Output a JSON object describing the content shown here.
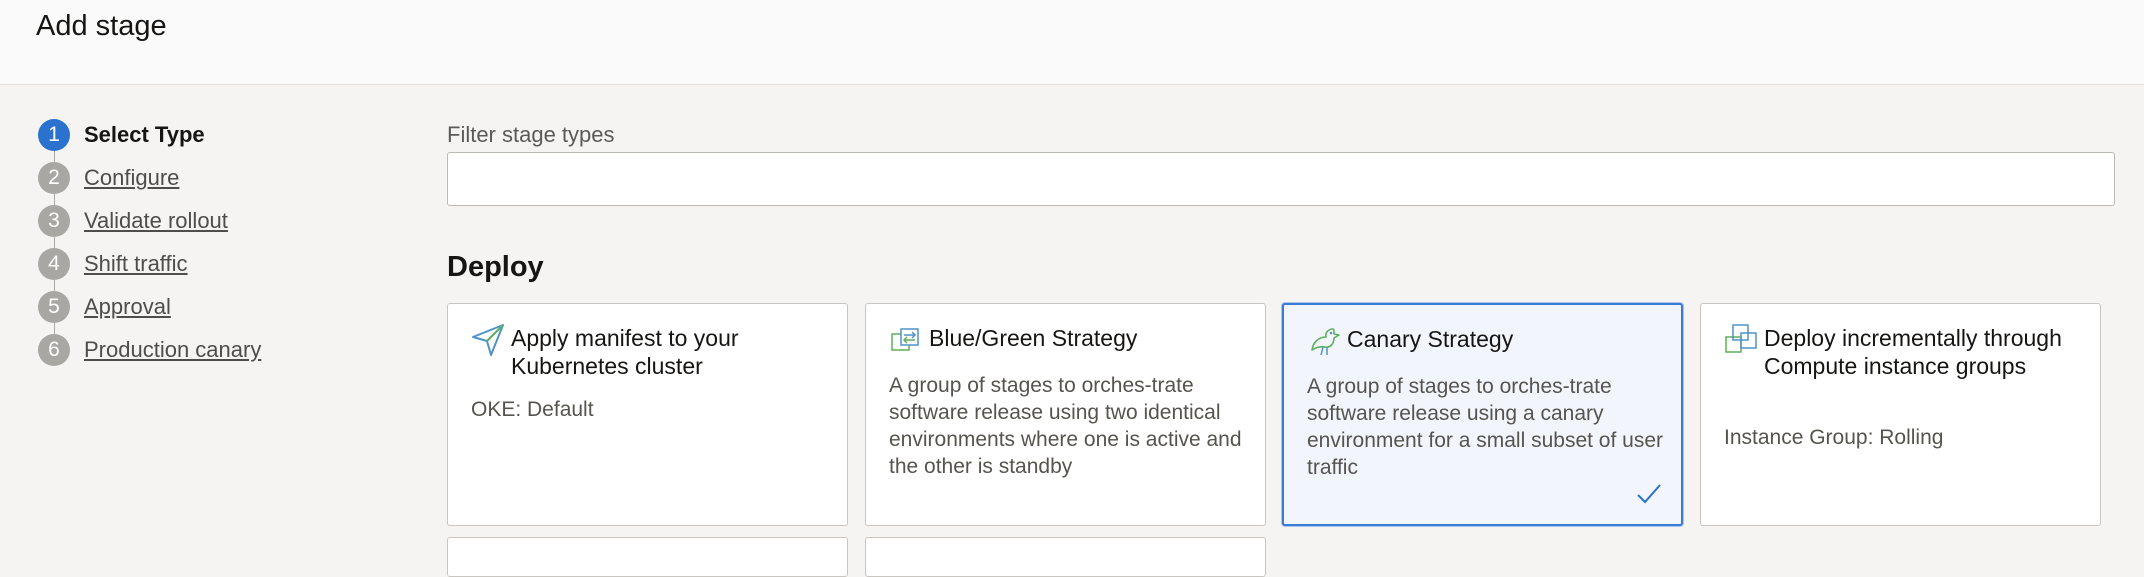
{
  "header": {
    "title": "Add stage"
  },
  "steps": [
    {
      "number": "1",
      "label": "Select Type"
    },
    {
      "number": "2",
      "label": "Configure"
    },
    {
      "number": "3",
      "label": "Validate rollout"
    },
    {
      "number": "4",
      "label": "Shift traffic"
    },
    {
      "number": "5",
      "label": "Approval"
    },
    {
      "number": "6",
      "label": "Production canary"
    }
  ],
  "filter": {
    "label": "Filter stage types",
    "value": ""
  },
  "section": {
    "title": "Deploy"
  },
  "cards": [
    {
      "icon": "paper-plane-icon",
      "title": "Apply manifest to your Kubernetes cluster",
      "description": "OKE: Default",
      "selected": false
    },
    {
      "icon": "swap-arrows-icon",
      "title": "Blue/Green Strategy",
      "description": "A group of stages to orches-trate software release using two identical environments where one is active and the other is standby",
      "selected": false
    },
    {
      "icon": "canary-bird-icon",
      "title": "Canary Strategy",
      "description": "A group of stages to orches-trate software release using a canary environment for a small subset of user traffic",
      "selected": true
    },
    {
      "icon": "instance-groups-icon",
      "title": "Deploy incrementally through Compute instance groups",
      "description": "Instance Group: Rolling",
      "selected": false
    }
  ],
  "colors": {
    "accent": "#2b72cf",
    "selected_border": "#3b7bd4",
    "icon_green": "#5fae5b",
    "icon_blue": "#4e93c8"
  }
}
